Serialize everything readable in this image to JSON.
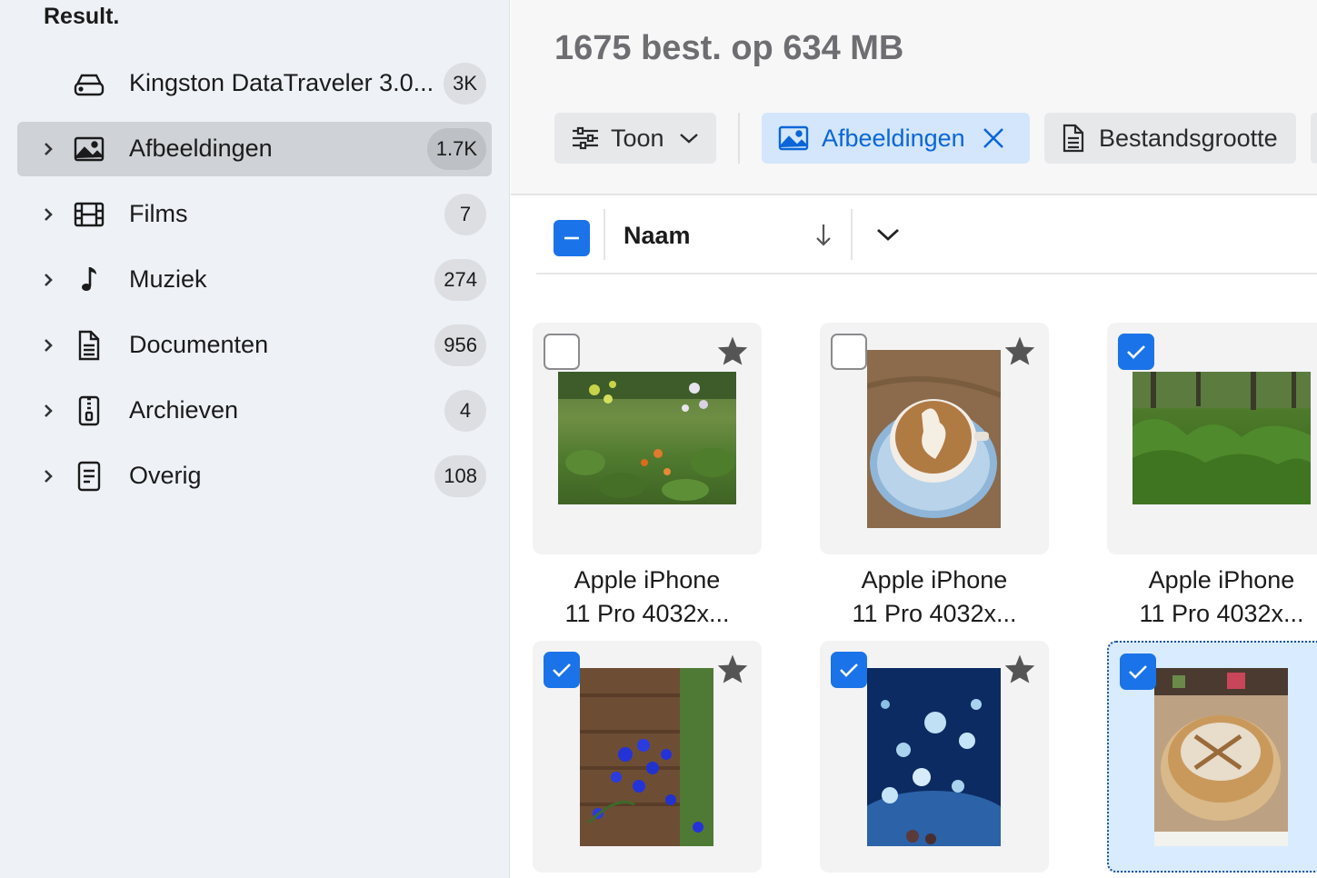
{
  "sidebar": {
    "title": "Result.",
    "items": [
      {
        "label": "Kingston DataTraveler 3.0...",
        "count": "3K",
        "icon": "drive-icon",
        "expandable": false,
        "selected": false
      },
      {
        "label": "Afbeeldingen",
        "count": "1.7K",
        "icon": "image-icon",
        "expandable": true,
        "selected": true
      },
      {
        "label": "Films",
        "count": "7",
        "icon": "film-icon",
        "expandable": true,
        "selected": false
      },
      {
        "label": "Muziek",
        "count": "274",
        "icon": "music-note-icon",
        "expandable": true,
        "selected": false
      },
      {
        "label": "Documenten",
        "count": "956",
        "icon": "document-icon",
        "expandable": true,
        "selected": false
      },
      {
        "label": "Archieven",
        "count": "4",
        "icon": "archive-icon",
        "expandable": true,
        "selected": false
      },
      {
        "label": "Overig",
        "count": "108",
        "icon": "other-file-icon",
        "expandable": true,
        "selected": false
      }
    ]
  },
  "header": {
    "summary": "1675 best. op 634 MB"
  },
  "filters": {
    "view_label": "Toon",
    "type_chip_label": "Afbeeldingen",
    "size_chip_label": "Bestandsgrootte"
  },
  "sort": {
    "label": "Naam",
    "direction": "descending"
  },
  "files": [
    {
      "line1": "Apple iPhone",
      "line2": "11 Pro 4032x...",
      "checked": false,
      "focused": false
    },
    {
      "line1": "Apple iPhone",
      "line2": "11 Pro 4032x...",
      "checked": false,
      "focused": false
    },
    {
      "line1": "Apple iPhone",
      "line2": "11 Pro 4032x...",
      "checked": true,
      "focused": false
    },
    {
      "line1": "",
      "line2": "",
      "checked": true,
      "focused": false
    },
    {
      "line1": "",
      "line2": "",
      "checked": true,
      "focused": false
    },
    {
      "line1": "",
      "line2": "",
      "checked": true,
      "focused": true
    }
  ],
  "colors": {
    "accent": "#1a73e8",
    "sidebar_bg": "#eef1f6",
    "selected_row": "#cfd2d6",
    "active_chip_bg": "#d3e6fb"
  }
}
